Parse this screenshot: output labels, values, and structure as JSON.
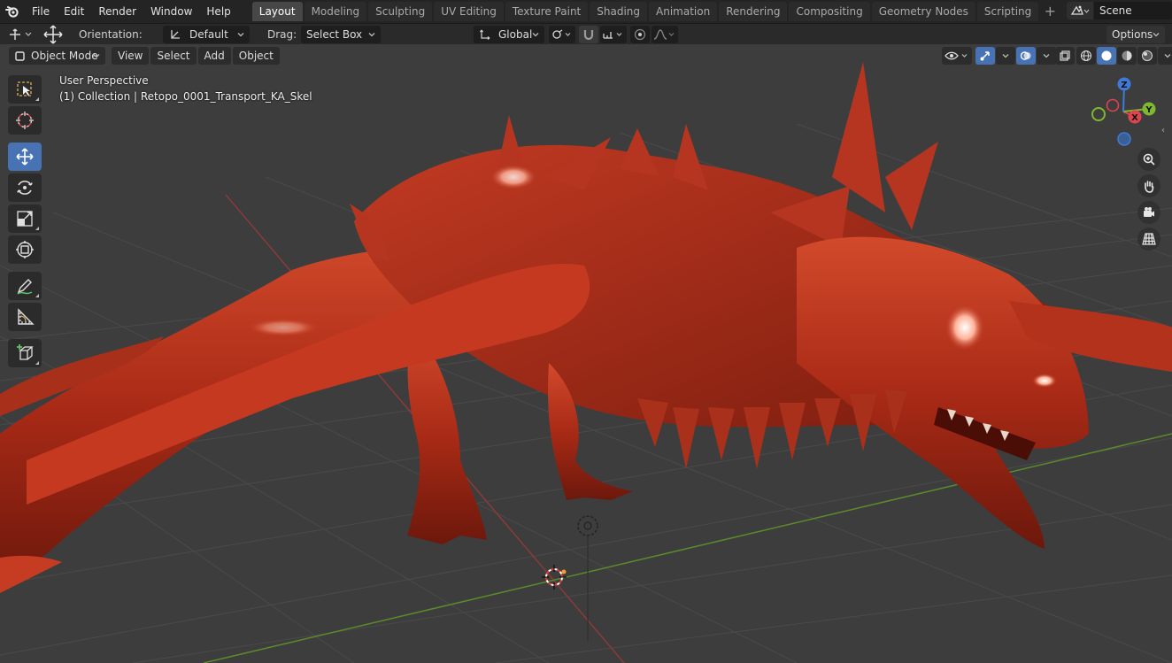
{
  "menubar": {
    "items": [
      "File",
      "Edit",
      "Render",
      "Window",
      "Help"
    ]
  },
  "workspaces": {
    "tabs": [
      "Layout",
      "Modeling",
      "Sculpting",
      "UV Editing",
      "Texture Paint",
      "Shading",
      "Animation",
      "Rendering",
      "Compositing",
      "Geometry Nodes",
      "Scripting"
    ],
    "active": "Layout",
    "add_symbol": "+"
  },
  "scene": {
    "name": "Scene"
  },
  "tool_header": {
    "orientation_label": "Orientation:",
    "orientation_value": "Default",
    "drag_label": "Drag:",
    "drag_value": "Select Box",
    "transform_orientation": "Global",
    "options_label": "Options"
  },
  "viewport_header": {
    "mode": "Object Mode",
    "view": "View",
    "select": "Select",
    "add": "Add",
    "object": "Object"
  },
  "viewport": {
    "perspective_label": "User Perspective",
    "collection_label": "(1) Collection | Retopo_0001_Transport_KA_Skel"
  },
  "gizmo": {
    "x_label": "X",
    "y_label": "Y",
    "z_label": "Z",
    "x_color": "#e0454f",
    "y_color": "#7fb82e",
    "z_color": "#3f7bd6"
  },
  "toolbar": {
    "tools": [
      "select-box",
      "cursor",
      "move",
      "rotate",
      "scale",
      "transform",
      "annotate",
      "measure",
      "add-cube"
    ],
    "active": "move"
  },
  "colors": {
    "accent": "#4772b3",
    "model": "#b8321c",
    "viewport_bg": "#3d3d3d"
  }
}
